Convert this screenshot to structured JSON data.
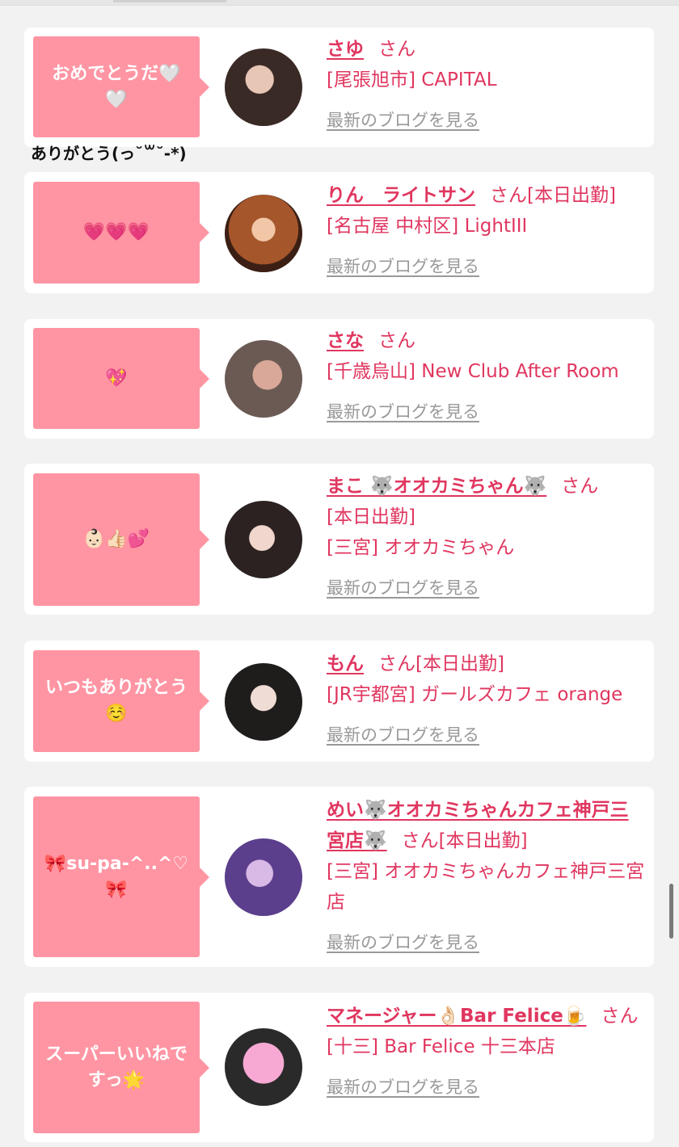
{
  "colors": {
    "accent": "#e0365f",
    "bubble": "#ff95a3",
    "link_gray": "#999999"
  },
  "cards": [
    {
      "message": "おめでとうだ🤍🤍",
      "name": "さゆ",
      "san": "さん",
      "tag": "",
      "shop": "[尾張旭市] CAPITAL",
      "blog": "最新のブログを見る",
      "avatar_icon": "girl-photo-icon"
    },
    {
      "message": "💗💗💗",
      "name": "りん　ライトサン",
      "san": "さん",
      "tag": "[本日出勤]",
      "shop": "[名古屋 中村区] LightIII",
      "blog": "最新のブログを見る",
      "avatar_icon": "girl-photo-icon"
    },
    {
      "message": "💖",
      "name": "さな",
      "san": "さん",
      "tag": "",
      "shop": "[千歳烏山] New Club After Room",
      "blog": "最新のブログを見る",
      "avatar_icon": "girl-photo-icon"
    },
    {
      "message": "👶🏻👍🏻💕",
      "name": "まこ 🐺オオカミちゃん🐺",
      "san": "さん",
      "tag": "[本日出勤]",
      "shop": "[三宮] オオカミちゃん",
      "blog": "最新のブログを見る",
      "avatar_icon": "girl-photo-icon"
    },
    {
      "message": "いつもありがとう☺️",
      "name": "もん",
      "san": "さん",
      "tag": "[本日出勤]",
      "shop": "[JR宇都宮] ガールズカフェ orange",
      "blog": "最新のブログを見る",
      "avatar_icon": "girl-photo-icon"
    },
    {
      "message": "🎀su-pa-^..^♡🎀",
      "name": "めい🐺オオカミちゃんカフェ神戸三宮店🐺",
      "san": "さん",
      "tag": "[本日出勤]",
      "shop": "[三宮] オオカミちゃんカフェ神戸三宮店",
      "blog": "最新のブログを見る",
      "avatar_icon": "girl-photo-icon"
    },
    {
      "message": "スーパーいいねですっ🌟",
      "name": "マネージャー👌🏻Bar Felice🍺",
      "san": "さん",
      "tag": "",
      "shop": "[十三] Bar Felice 十三本店",
      "blog": "最新のブログを見る",
      "avatar_icon": "heart-covered-photo-icon"
    }
  ],
  "sub_message": "ありがとう(っ˘꒳˘-*)"
}
